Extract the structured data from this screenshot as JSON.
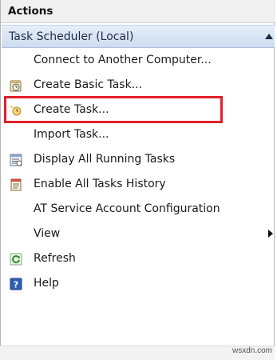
{
  "pane": {
    "title": "Actions"
  },
  "section": {
    "title": "Task Scheduler (Local)",
    "expanded": true
  },
  "items": [
    {
      "label": "Connect to Another Computer...",
      "icon": null
    },
    {
      "label": "Create Basic Task...",
      "icon": "clock-task-icon"
    },
    {
      "label": "Create Task...",
      "icon": "new-task-icon",
      "highlighted": true
    },
    {
      "label": "Import Task...",
      "icon": null
    },
    {
      "label": "Display All Running Tasks",
      "icon": "running-tasks-icon"
    },
    {
      "label": "Enable All Tasks History",
      "icon": "task-history-icon"
    },
    {
      "label": "AT Service Account Configuration",
      "icon": null
    },
    {
      "label": "View",
      "icon": null,
      "submenu": true
    },
    {
      "label": "Refresh",
      "icon": "refresh-icon"
    },
    {
      "label": "Help",
      "icon": "help-icon"
    }
  ],
  "highlight_color": "#e0202a",
  "watermark": "wsxdn.com"
}
